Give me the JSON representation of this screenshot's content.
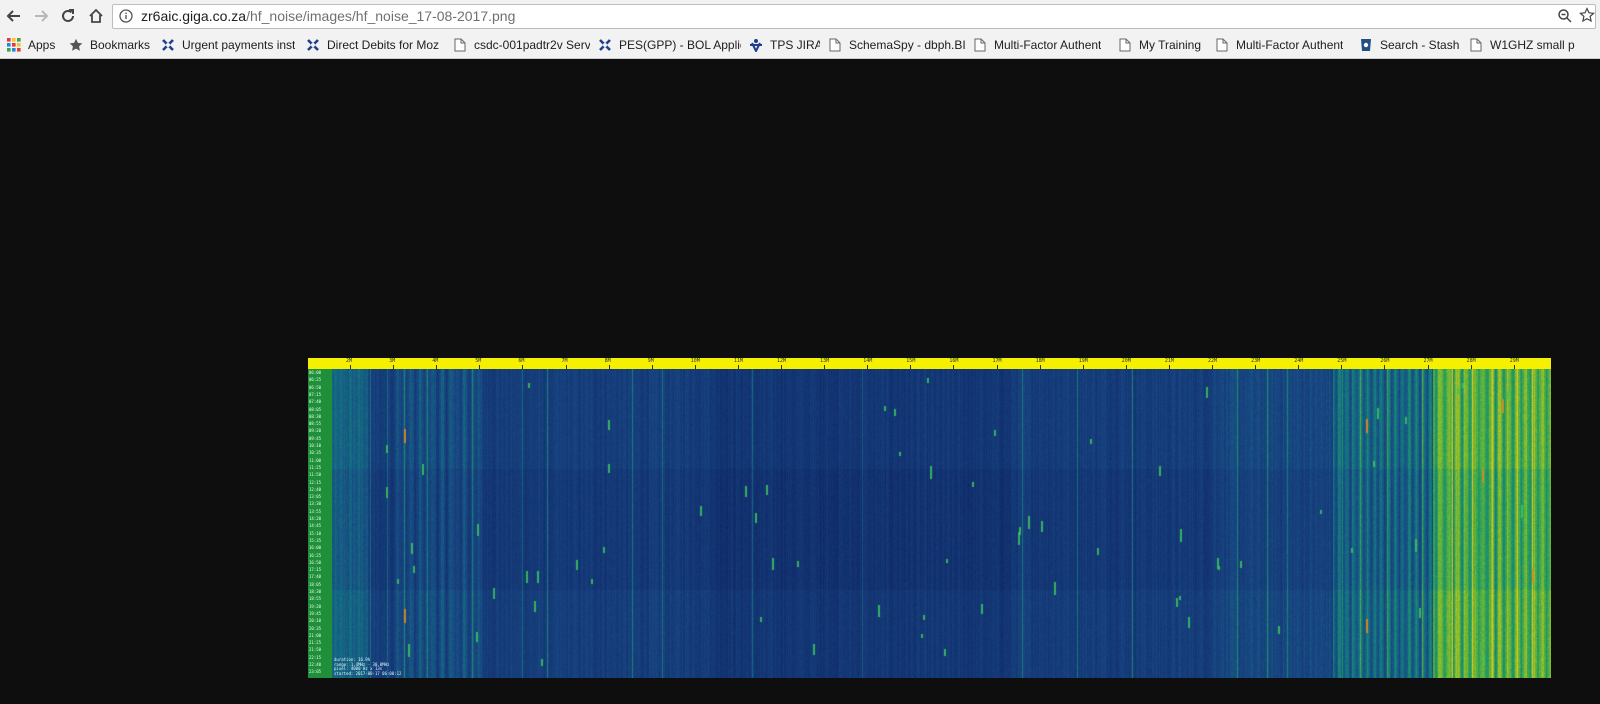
{
  "browser": {
    "url_host": "zr6aic.giga.co.za",
    "url_path": "/hf_noise/images/hf_noise_17-08-2017.png"
  },
  "bookmarks": [
    {
      "label": "Apps",
      "icon": "apps-grid-icon"
    },
    {
      "label": "Bookmarks",
      "icon": "star-icon"
    },
    {
      "label": "Urgent payments inst",
      "icon": "app-logo-icon"
    },
    {
      "label": "Direct Debits for Moz",
      "icon": "app-logo-icon"
    },
    {
      "label": "csdc-001padtr2v Serv",
      "icon": "page-icon"
    },
    {
      "label": "PES(GPP) - BOL Applic",
      "icon": "app-logo-icon"
    },
    {
      "label": "TPS JIRA",
      "icon": "jira-icon"
    },
    {
      "label": "SchemaSpy - dbph.BI",
      "icon": "page-icon"
    },
    {
      "label": "Multi-Factor Authent",
      "icon": "page-icon"
    },
    {
      "label": "My Training",
      "icon": "page-icon"
    },
    {
      "label": "Multi-Factor Authent",
      "icon": "page-icon"
    },
    {
      "label": "Search - Stash",
      "icon": "stash-icon"
    },
    {
      "label": "W1GHZ small p",
      "icon": "page-icon"
    }
  ],
  "spectrogram": {
    "freq_labels": [
      "2M",
      "3M",
      "4M",
      "5M",
      "6M",
      "7M",
      "8M",
      "9M",
      "10M",
      "11M",
      "12M",
      "13M",
      "14M",
      "15M",
      "16M",
      "17M",
      "18M",
      "19M",
      "20M",
      "21M",
      "22M",
      "23M",
      "24M",
      "25M",
      "26M",
      "27M",
      "28M",
      "29M"
    ],
    "time_labels": [
      "06:00",
      "06:25",
      "06:50",
      "07:15",
      "07:40",
      "08:05",
      "08:30",
      "08:55",
      "09:20",
      "09:45",
      "10:10",
      "10:35",
      "11:00",
      "11:25",
      "11:50",
      "12:15",
      "12:40",
      "13:05",
      "13:30",
      "13:55",
      "14:20",
      "14:45",
      "15:10",
      "15:35",
      "16:00",
      "16:25",
      "16:50",
      "17:15",
      "17:40",
      "18:05",
      "18:30",
      "18:55",
      "19:20",
      "19:45",
      "20:10",
      "20:35",
      "21:00",
      "21:25",
      "21:50",
      "22:15",
      "22:40",
      "23:05"
    ],
    "info_lines": [
      "duration: 16.9h",
      "range: 1.4MHz - 30.0MHz",
      "pixel: 4000 Hz x 13s",
      "started: 2017-08-17 06:00:12"
    ]
  }
}
